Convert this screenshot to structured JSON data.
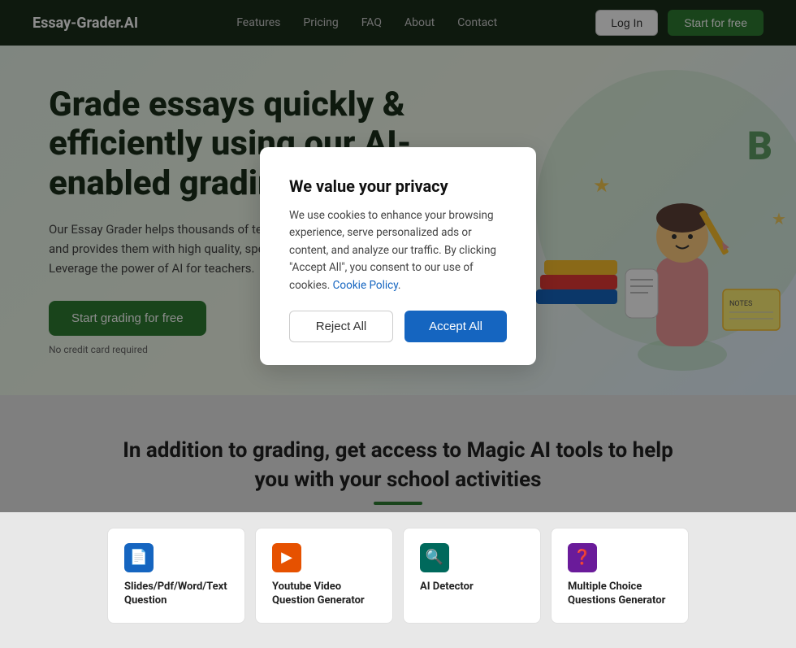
{
  "nav": {
    "logo": "Essay-Grader.AI",
    "links": [
      {
        "label": "Features",
        "href": "#"
      },
      {
        "label": "Pricing",
        "href": "#"
      },
      {
        "label": "FAQ",
        "href": "#"
      },
      {
        "label": "About",
        "href": "#"
      },
      {
        "label": "Contact",
        "href": "#"
      }
    ],
    "login_label": "Log In",
    "start_label": "Start for free"
  },
  "hero": {
    "title": "Grade essays quickly & efficiently using our AI-enabled grading tools",
    "subtitle": "Our Essay Grader helps thousands of teachers grade essays in seconds and provides them with high quality, specific feedback on essays. Leverage the power of AI for teachers.",
    "cta_label": "Start grading for free",
    "note": "No credit card required"
  },
  "tools_section": {
    "heading": "In addition to grading, get access to Magic AI tools to help you with your school activities",
    "cards": [
      {
        "title": "Slides/Pdf/Word/Text Question",
        "icon": "📄",
        "icon_class": "icon-blue"
      },
      {
        "title": "Youtube Video Question Generator",
        "icon": "▶",
        "icon_class": "icon-orange"
      },
      {
        "title": "AI Detector",
        "icon": "🔍",
        "icon_class": "icon-teal"
      },
      {
        "title": "Multiple Choice Questions Generator",
        "icon": "❓",
        "icon_class": "icon-purple"
      }
    ]
  },
  "modal": {
    "title": "We value your privacy",
    "body": "We use cookies to enhance your browsing experience, serve personalized ads or content, and analyze our traffic. By clicking \"Accept All\", you consent to our use of cookies.",
    "policy_link_text": "Cookie Policy",
    "reject_label": "Reject All",
    "accept_label": "Accept All"
  }
}
